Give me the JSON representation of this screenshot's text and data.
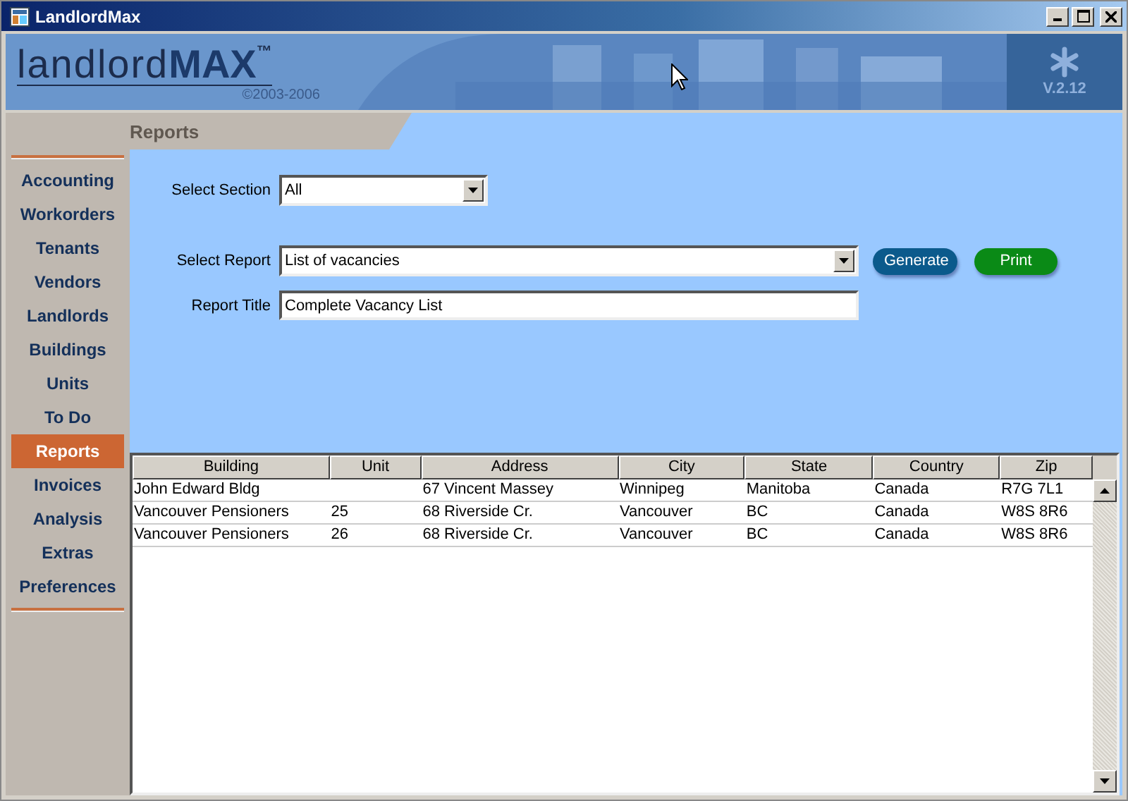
{
  "window": {
    "title": "LandlordMax"
  },
  "banner": {
    "logo_light": "landlord",
    "logo_bold": "MAX",
    "trademark": "™",
    "copyright": "©2003-2006",
    "version": "V.2.12"
  },
  "section_header": "Reports",
  "sidebar": {
    "items": [
      {
        "label": "Accounting",
        "selected": false
      },
      {
        "label": "Workorders",
        "selected": false
      },
      {
        "label": "Tenants",
        "selected": false
      },
      {
        "label": "Vendors",
        "selected": false
      },
      {
        "label": "Landlords",
        "selected": false
      },
      {
        "label": "Buildings",
        "selected": false
      },
      {
        "label": "Units",
        "selected": false
      },
      {
        "label": "To Do",
        "selected": false
      },
      {
        "label": "Reports",
        "selected": true
      },
      {
        "label": "Invoices",
        "selected": false
      },
      {
        "label": "Analysis",
        "selected": false
      },
      {
        "label": "Extras",
        "selected": false
      },
      {
        "label": "Preferences",
        "selected": false
      }
    ]
  },
  "form": {
    "section": {
      "label": "Select Section",
      "value": "All"
    },
    "report": {
      "label": "Select Report",
      "value": "List of vacancies"
    },
    "title": {
      "label": "Report Title",
      "value": "Complete Vacancy List"
    },
    "buttons": [
      {
        "label": "Generate",
        "kind": "blue"
      },
      {
        "label": "Print",
        "kind": "green"
      }
    ]
  },
  "table": {
    "columns": [
      "Building",
      "Unit",
      "Address",
      "City",
      "State",
      "Country",
      "Zip"
    ],
    "rows": [
      [
        "John Edward Bldg",
        "",
        "67 Vincent Massey",
        "Winnipeg",
        "Manitoba",
        "Canada",
        "R7G 7L1"
      ],
      [
        "Vancouver Pensioners",
        "25",
        "68 Riverside Cr.",
        "Vancouver",
        "BC",
        "Canada",
        "W8S 8R6"
      ],
      [
        "Vancouver Pensioners",
        "26",
        "68 Riverside Cr.",
        "Vancouver",
        "BC",
        "Canada",
        "W8S 8R6"
      ]
    ]
  }
}
